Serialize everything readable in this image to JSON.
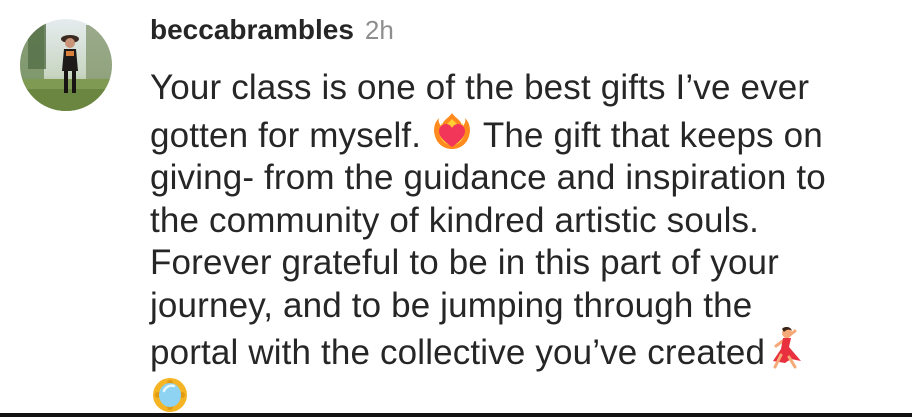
{
  "comment": {
    "username": "beccabrambles",
    "timestamp": "2h",
    "avatar_icon": "profile-photo-avatar",
    "lines": [
      "Your class is one of the best gifts I’ve ever",
      "gotten for myself.",
      "The gift that keeps on",
      "giving- from the guidance and inspiration to",
      "the community of kindred artistic souls.",
      "Forever grateful to be in this part of your",
      "journey, and to be jumping through the",
      "portal with the collective you’ve created"
    ],
    "emojis": [
      "heart-on-fire-icon",
      "dancer-icon",
      "mirror-icon"
    ]
  },
  "colors": {
    "text": "#262626",
    "secondary_text": "#8e8e8e",
    "background": "#ffffff",
    "divider": "#111111"
  }
}
